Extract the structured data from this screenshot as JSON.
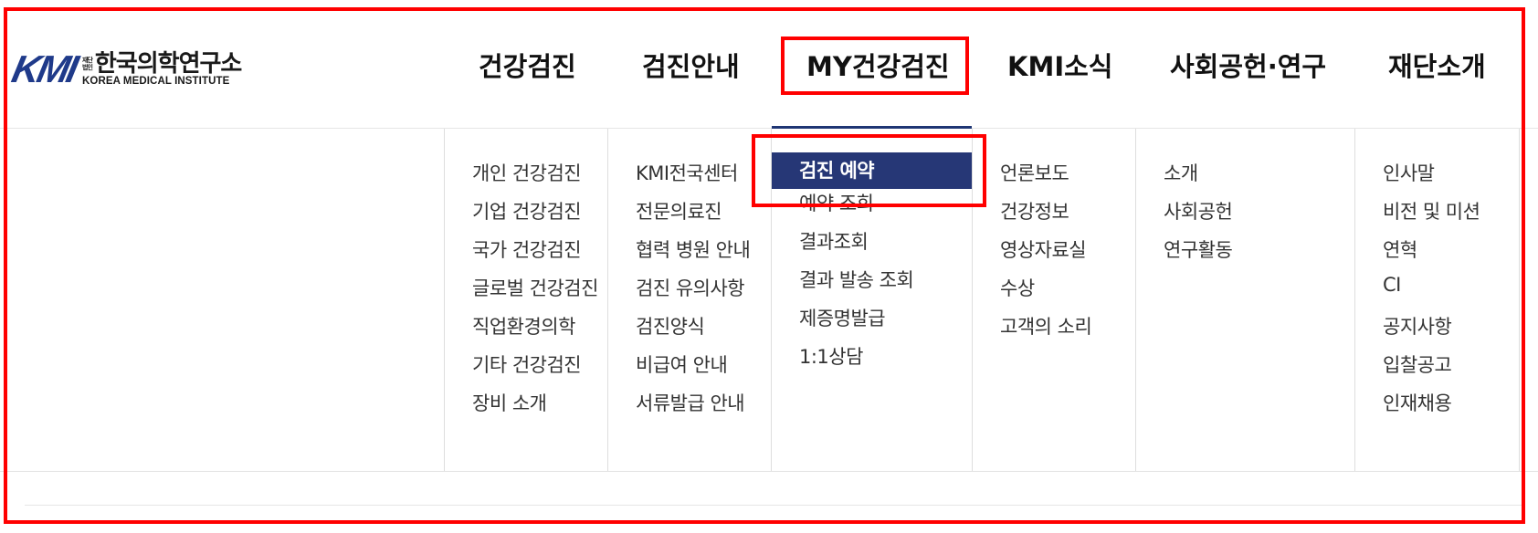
{
  "logo": {
    "mark": "KMI",
    "tag_top": "재단",
    "tag_bottom": "법인",
    "name_kr": "한국의학연구소",
    "name_en": "KOREA MEDICAL INSTITUTE"
  },
  "nav": {
    "items": [
      {
        "label": "건강검진"
      },
      {
        "label": "검진안내"
      },
      {
        "label": "MY건강검진"
      },
      {
        "label": "KMI소식"
      },
      {
        "label": "사회공헌·연구"
      },
      {
        "label": "재단소개"
      }
    ]
  },
  "submenus": [
    {
      "items": [
        "개인 건강검진",
        "기업 건강검진",
        "국가 건강검진",
        "글로벌 건강검진",
        "직업환경의학",
        "기타 건강검진",
        "장비 소개"
      ]
    },
    {
      "items": [
        "KMI전국센터",
        "전문의료진",
        "협력 병원 안내",
        "검진 유의사항",
        "검진양식",
        "비급여 안내",
        "서류발급 안내"
      ]
    },
    {
      "items": [
        "검진 예약",
        "예약 조회",
        "결과조회",
        "결과 발송 조회",
        "제증명발급",
        "1:1상담"
      ]
    },
    {
      "items": [
        "언론보도",
        "건강정보",
        "영상자료실",
        "수상",
        "고객의 소리"
      ]
    },
    {
      "items": [
        "소개",
        "사회공헌",
        "연구활동"
      ]
    },
    {
      "items": [
        "인사말",
        "비전 및 미션",
        "연혁",
        "CI",
        "공지사항",
        "입찰공고",
        "인재채용"
      ]
    }
  ],
  "colors": {
    "brand": "#1f3a8a",
    "highlight_bg": "#263776",
    "annotation": "#ff0000"
  }
}
